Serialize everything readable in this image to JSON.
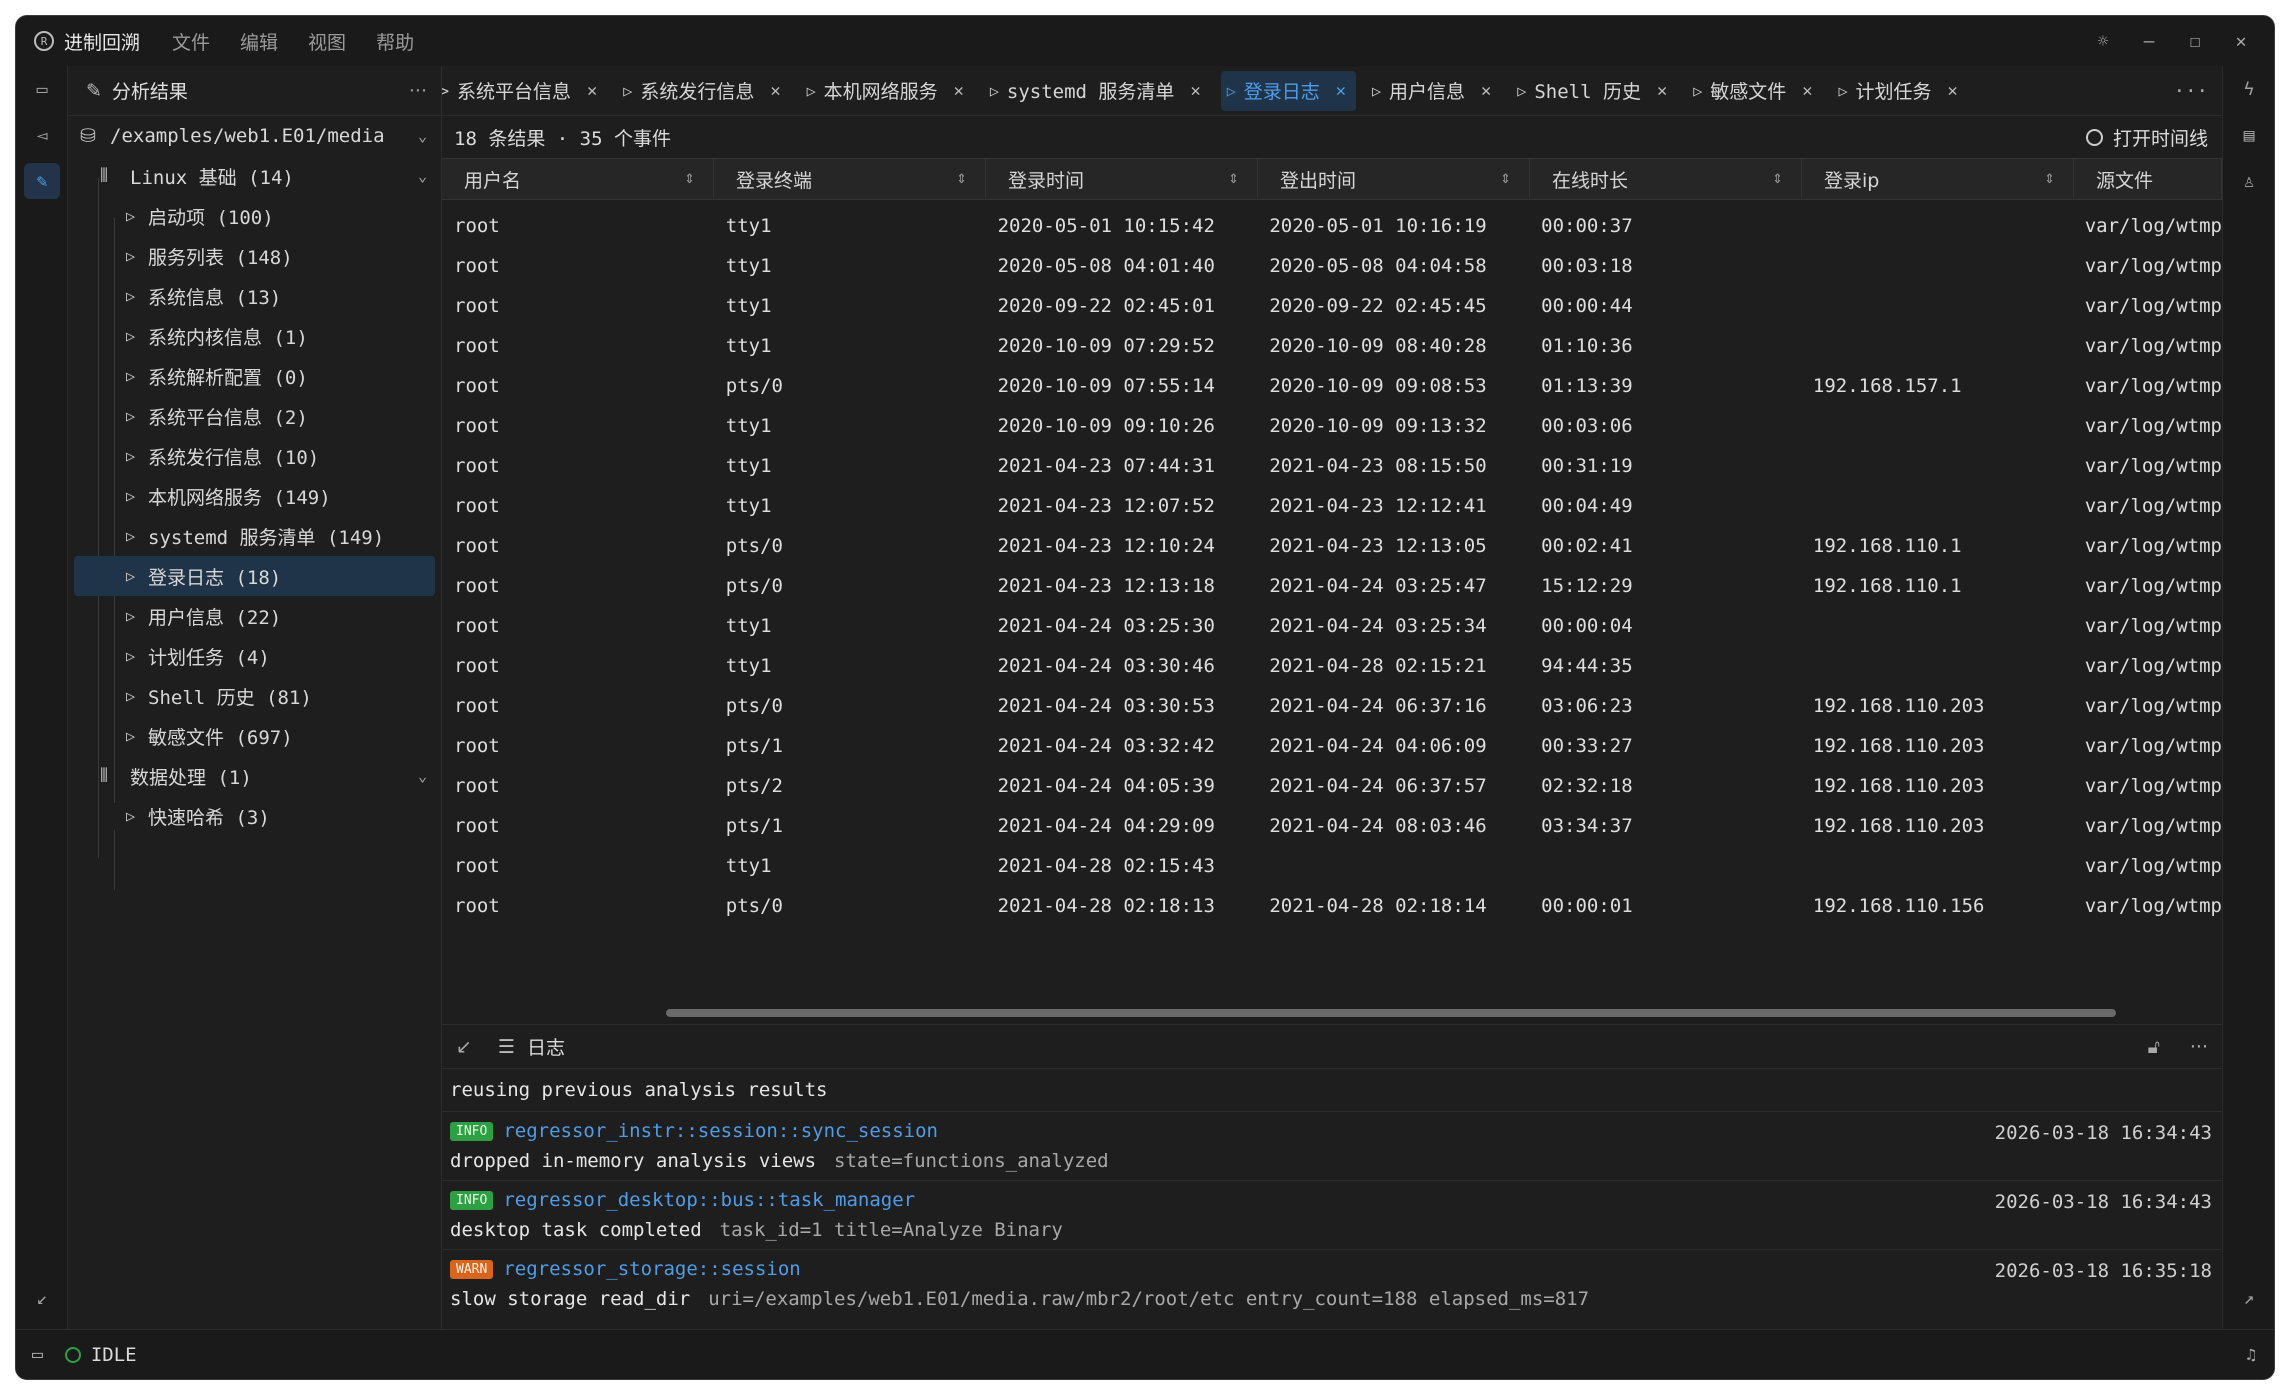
{
  "app": {
    "title": "进制回溯",
    "menus": [
      "文件",
      "编辑",
      "视图",
      "帮助"
    ]
  },
  "sidebar": {
    "title": "分析结果",
    "root": "/examples/web1.E01/media",
    "groups": [
      {
        "label": "Linux 基础 (14)",
        "items": [
          "启动项 (100)",
          "服务列表 (148)",
          "系统信息 (13)",
          "系统内核信息 (1)",
          "系统解析配置 (0)",
          "系统平台信息 (2)",
          "系统发行信息 (10)",
          "本机网络服务 (149)",
          "systemd 服务清单 (149)",
          "登录日志 (18)",
          "用户信息 (22)",
          "计划任务 (4)",
          "Shell 历史 (81)",
          "敏感文件 (697)"
        ]
      },
      {
        "label": "数据处理 (1)",
        "items": [
          "快速哈希 (3)"
        ]
      }
    ],
    "selected": "登录日志 (18)"
  },
  "tabs": [
    {
      "label": "系统平台信息",
      "active": false,
      "prefix": ">"
    },
    {
      "label": "系统发行信息",
      "active": false
    },
    {
      "label": "本机网络服务",
      "active": false
    },
    {
      "label": "systemd 服务清单",
      "active": false
    },
    {
      "label": "登录日志",
      "active": true
    },
    {
      "label": "用户信息",
      "active": false
    },
    {
      "label": "Shell 历史",
      "active": false
    },
    {
      "label": "敏感文件",
      "active": false
    },
    {
      "label": "计划任务",
      "active": false
    }
  ],
  "results": {
    "summary": "18 条结果 · 35 个事件",
    "timeline_label": "打开时间线"
  },
  "table": {
    "columns": [
      "用户名",
      "登录终端",
      "登录时间",
      "登出时间",
      "在线时长",
      "登录ip",
      "源文件"
    ],
    "rows": [
      [
        "root",
        "tty1",
        "2020-05-01 10:15:42",
        "2020-05-01 10:16:19",
        "00:00:37",
        "",
        "var/log/wtmp"
      ],
      [
        "root",
        "tty1",
        "2020-05-08 04:01:40",
        "2020-05-08 04:04:58",
        "00:03:18",
        "",
        "var/log/wtmp"
      ],
      [
        "root",
        "tty1",
        "2020-09-22 02:45:01",
        "2020-09-22 02:45:45",
        "00:00:44",
        "",
        "var/log/wtmp"
      ],
      [
        "root",
        "tty1",
        "2020-10-09 07:29:52",
        "2020-10-09 08:40:28",
        "01:10:36",
        "",
        "var/log/wtmp"
      ],
      [
        "root",
        "pts/0",
        "2020-10-09 07:55:14",
        "2020-10-09 09:08:53",
        "01:13:39",
        "192.168.157.1",
        "var/log/wtmp"
      ],
      [
        "root",
        "tty1",
        "2020-10-09 09:10:26",
        "2020-10-09 09:13:32",
        "00:03:06",
        "",
        "var/log/wtmp"
      ],
      [
        "root",
        "tty1",
        "2021-04-23 07:44:31",
        "2021-04-23 08:15:50",
        "00:31:19",
        "",
        "var/log/wtmp"
      ],
      [
        "root",
        "tty1",
        "2021-04-23 12:07:52",
        "2021-04-23 12:12:41",
        "00:04:49",
        "",
        "var/log/wtmp"
      ],
      [
        "root",
        "pts/0",
        "2021-04-23 12:10:24",
        "2021-04-23 12:13:05",
        "00:02:41",
        "192.168.110.1",
        "var/log/wtmp"
      ],
      [
        "root",
        "pts/0",
        "2021-04-23 12:13:18",
        "2021-04-24 03:25:47",
        "15:12:29",
        "192.168.110.1",
        "var/log/wtmp"
      ],
      [
        "root",
        "tty1",
        "2021-04-24 03:25:30",
        "2021-04-24 03:25:34",
        "00:00:04",
        "",
        "var/log/wtmp"
      ],
      [
        "root",
        "tty1",
        "2021-04-24 03:30:46",
        "2021-04-28 02:15:21",
        "94:44:35",
        "",
        "var/log/wtmp"
      ],
      [
        "root",
        "pts/0",
        "2021-04-24 03:30:53",
        "2021-04-24 06:37:16",
        "03:06:23",
        "192.168.110.203",
        "var/log/wtmp"
      ],
      [
        "root",
        "pts/1",
        "2021-04-24 03:32:42",
        "2021-04-24 04:06:09",
        "00:33:27",
        "192.168.110.203",
        "var/log/wtmp"
      ],
      [
        "root",
        "pts/2",
        "2021-04-24 04:05:39",
        "2021-04-24 06:37:57",
        "02:32:18",
        "192.168.110.203",
        "var/log/wtmp"
      ],
      [
        "root",
        "pts/1",
        "2021-04-24 04:29:09",
        "2021-04-24 08:03:46",
        "03:34:37",
        "192.168.110.203",
        "var/log/wtmp"
      ],
      [
        "root",
        "tty1",
        "2021-04-28 02:15:43",
        "",
        "",
        "",
        "var/log/wtmp"
      ],
      [
        "root",
        "pts/0",
        "2021-04-28 02:18:13",
        "2021-04-28 02:18:14",
        "00:00:01",
        "192.168.110.156",
        "var/log/wtmp"
      ]
    ]
  },
  "log": {
    "title": "日志",
    "first_line": "reusing previous analysis results",
    "entries": [
      {
        "level": "INFO",
        "target": "regressor_instr::session::sync_session",
        "time": "2026-03-18 16:34:43",
        "message": "dropped in-memory analysis views",
        "fields": "state=functions_analyzed"
      },
      {
        "level": "INFO",
        "target": "regressor_desktop::bus::task_manager",
        "time": "2026-03-18 16:34:43",
        "message": "desktop task completed",
        "fields": "task_id=1  title=Analyze Binary"
      },
      {
        "level": "WARN",
        "target": "regressor_storage::session",
        "time": "2026-03-18 16:35:18",
        "message": "slow storage read_dir",
        "fields": "uri=/examples/web1.E01/media.raw/mbr2/root/etc  entry_count=188  elapsed_ms=817"
      }
    ]
  },
  "status": {
    "state": "IDLE"
  },
  "colors": {
    "accent": "#4f9de8",
    "info": "#2ea043",
    "warn": "#d9651c",
    "background": "#1e1e1e"
  }
}
